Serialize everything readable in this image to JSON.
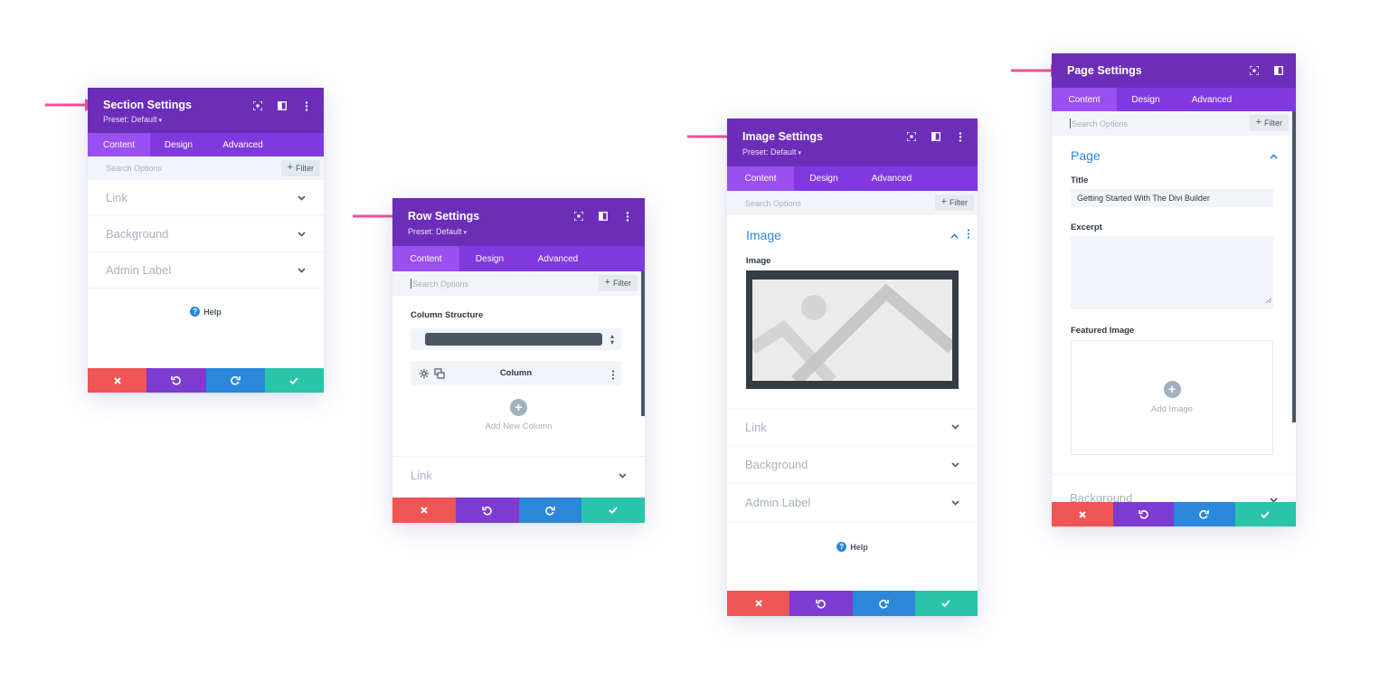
{
  "colors": {
    "header": "#6c2eb9",
    "tabs": "#8039df",
    "tab_active": "#9a4ff0",
    "arrow": "#ef4f9b",
    "cancel": "#ef5555",
    "undo": "#7d3bcf",
    "redo": "#2b87da",
    "save": "#29c4a9",
    "accent_blue": "#2b87da"
  },
  "section_panel": {
    "title": "Section Settings",
    "preset": "Preset: Default",
    "tabs": [
      "Content",
      "Design",
      "Advanced"
    ],
    "search_placeholder": "Search Options",
    "filter_label": "Filter",
    "toggles": [
      "Link",
      "Background",
      "Admin Label"
    ],
    "help_label": "Help"
  },
  "row_panel": {
    "title": "Row Settings",
    "preset": "Preset: Default",
    "tabs": [
      "Content",
      "Design",
      "Advanced"
    ],
    "search_placeholder": "Search Options",
    "filter_label": "Filter",
    "column_structure_label": "Column Structure",
    "column_label": "Column",
    "add_column_label": "Add New Column",
    "toggles": [
      "Link"
    ]
  },
  "image_panel": {
    "title": "Image Settings",
    "preset": "Preset: Default",
    "tabs": [
      "Content",
      "Design",
      "Advanced"
    ],
    "search_placeholder": "Search Options",
    "filter_label": "Filter",
    "section_title": "Image",
    "image_field_label": "Image",
    "toggles": [
      "Link",
      "Background",
      "Admin Label"
    ],
    "help_label": "Help"
  },
  "page_panel": {
    "title": "Page Settings",
    "tabs": [
      "Content",
      "Design",
      "Advanced"
    ],
    "search_placeholder": "Search Options",
    "filter_label": "Filter",
    "section_title": "Page",
    "title_label": "Title",
    "title_value": "Getting Started With The Divi Builder",
    "excerpt_label": "Excerpt",
    "featured_label": "Featured Image",
    "add_image_label": "Add Image",
    "toggles": [
      "Background"
    ]
  },
  "icons": {
    "expand": "expand-icon",
    "sidebar": "sidebar-icon",
    "more": "more-icon",
    "cancel": "close-icon",
    "undo": "undo-icon",
    "redo": "redo-icon",
    "save": "check-icon"
  }
}
